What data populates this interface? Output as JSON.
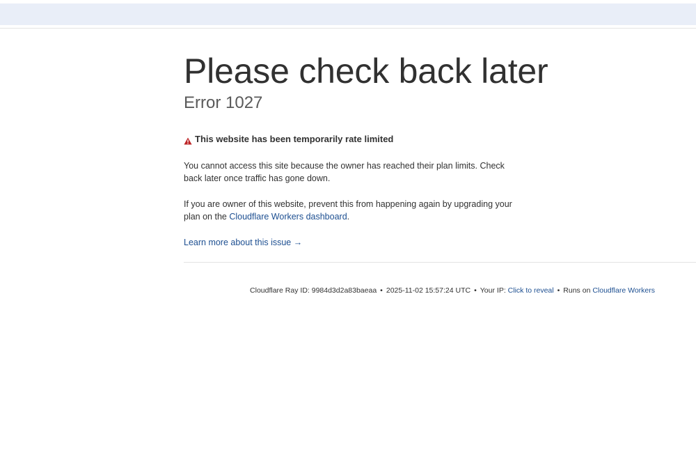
{
  "headline": "Please check back later",
  "error_code": "Error 1027",
  "warning": {
    "icon": "warning-triangle-icon",
    "icon_color": "#bd2426",
    "text": "This website has been temporarily rate limited"
  },
  "paragraph1": "You cannot access this site because the owner has reached their plan limits. Check back later once traffic has gone down.",
  "paragraph2": {
    "prefix": "If you are owner of this website, prevent this from happening again by upgrading your plan on the ",
    "link_text": "Cloudflare Workers dashboard",
    "suffix": "."
  },
  "learn_more": "Learn more about this issue →",
  "footer": {
    "ray_id": "Cloudflare Ray ID: 9984d3d2a83baeaa",
    "timestamp": "2025-11-02 15:57:24 UTC",
    "your_ip_label": "Your IP: ",
    "reveal_link": "Click to reveal",
    "runs_on_label": "Runs on ",
    "workers_link": "Cloudflare Workers",
    "separator": "•"
  },
  "colors": {
    "link": "#1d4f91",
    "text": "#313131",
    "browser_bar": "#e9eef8"
  }
}
